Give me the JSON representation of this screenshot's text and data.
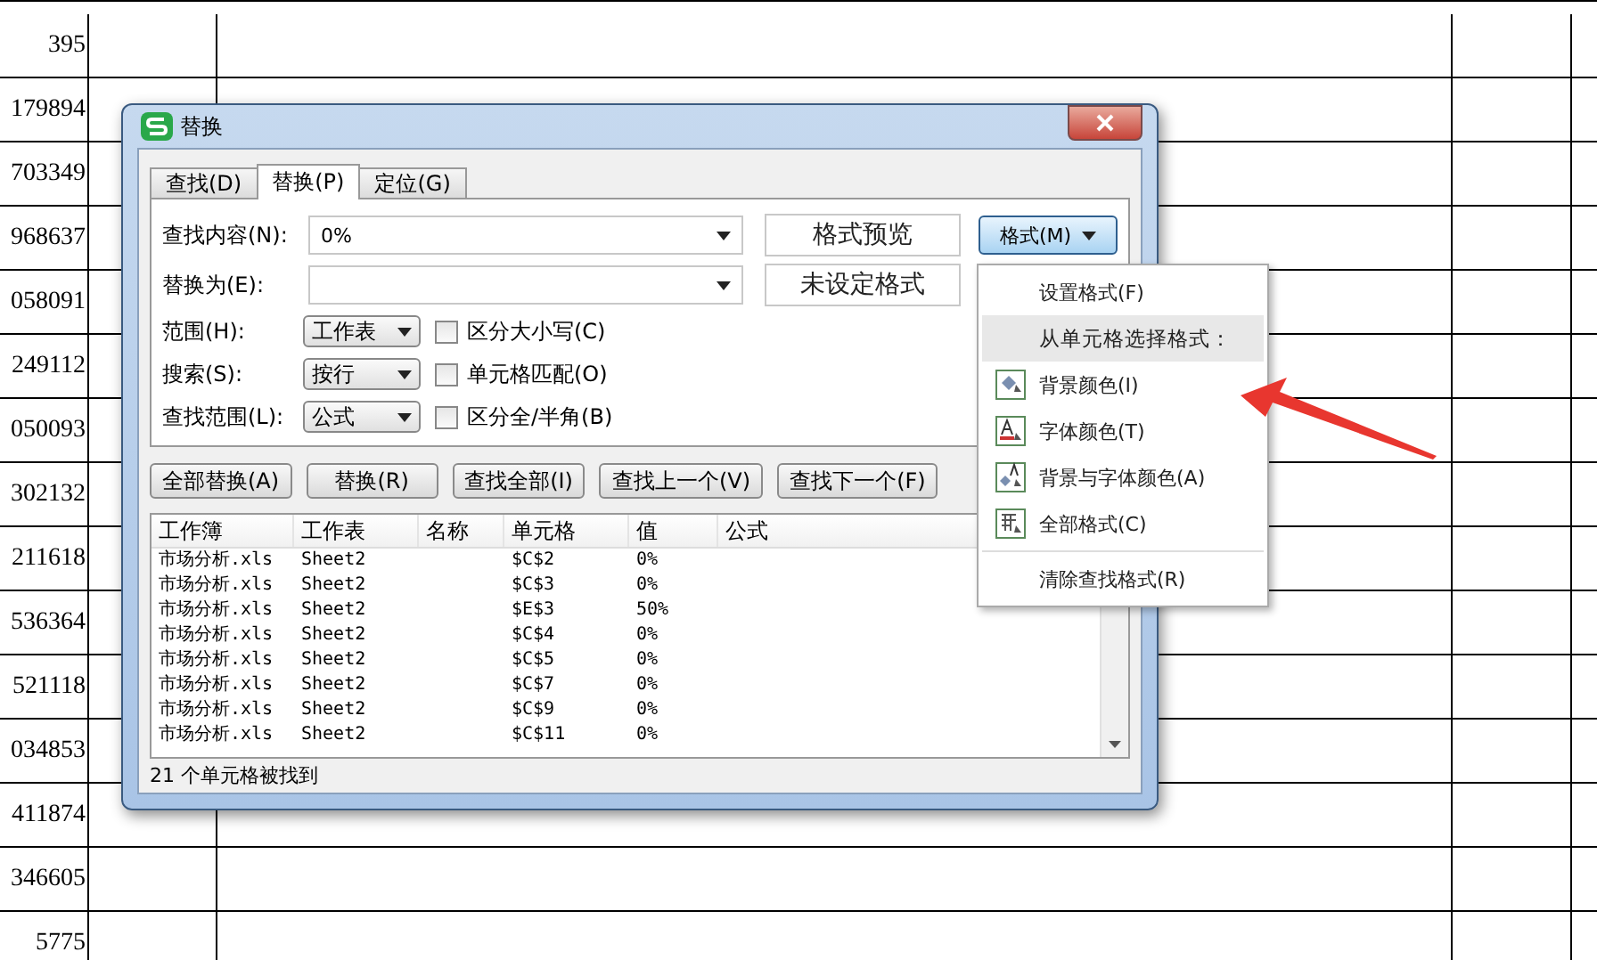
{
  "sheet": {
    "rows": [
      "395",
      "179894",
      "703349",
      "968637",
      "058091",
      "249112",
      "050093",
      "302132",
      "211618",
      "536364",
      "521118",
      "034853",
      "411874",
      "346605",
      "5775"
    ]
  },
  "window": {
    "title": "替换"
  },
  "tabs": [
    {
      "label": "查找(D)",
      "selected": false
    },
    {
      "label": "替换(P)",
      "selected": true
    },
    {
      "label": "定位(G)",
      "selected": false
    }
  ],
  "find_what": {
    "label": "查找内容(N):",
    "value": "0%"
  },
  "replace_with": {
    "label": "替换为(E):"
  },
  "format_preview": "格式预览",
  "format_status": "未设定格式",
  "format_button": {
    "label": "格式(M)",
    "expanded": true
  },
  "options": [
    {
      "label": "范围(H):",
      "value": "工作表",
      "checkbox_label": "区分大小写(C)",
      "checked": false
    },
    {
      "label": "搜索(S):",
      "value": "按行",
      "checkbox_label": "单元格匹配(O)",
      "checked": false
    },
    {
      "label": "查找范围(L):",
      "value": "公式",
      "checkbox_label": "区分全/半角(B)",
      "checked": false
    }
  ],
  "action_buttons": [
    "全部替换(A)",
    "替换(R)",
    "查找全部(I)",
    "查找上一个(V)",
    "查找下一个(F)"
  ],
  "results": {
    "columns": [
      "工作簿",
      "工作表",
      "名称",
      "单元格",
      "值",
      "公式"
    ],
    "rows": [
      [
        "市场分析.xls",
        "Sheet2",
        "",
        "$C$2",
        "0%",
        ""
      ],
      [
        "市场分析.xls",
        "Sheet2",
        "",
        "$C$3",
        "0%",
        ""
      ],
      [
        "市场分析.xls",
        "Sheet2",
        "",
        "$E$3",
        "50%",
        ""
      ],
      [
        "市场分析.xls",
        "Sheet2",
        "",
        "$C$4",
        "0%",
        ""
      ],
      [
        "市场分析.xls",
        "Sheet2",
        "",
        "$C$5",
        "0%",
        ""
      ],
      [
        "市场分析.xls",
        "Sheet2",
        "",
        "$C$7",
        "0%",
        ""
      ],
      [
        "市场分析.xls",
        "Sheet2",
        "",
        "$C$9",
        "0%",
        ""
      ],
      [
        "市场分析.xls",
        "Sheet2",
        "",
        "$C$11",
        "0%",
        ""
      ]
    ]
  },
  "status_text": "21 个单元格被找到",
  "format_menu": {
    "items": [
      {
        "label": "设置格式(F)",
        "kind": "plain",
        "selected": false
      },
      {
        "label": "从单元格选择格式：",
        "kind": "header",
        "selected": true
      },
      {
        "label": "背景颜色(I)",
        "kind": "background",
        "selected": false
      },
      {
        "label": "字体颜色(T)",
        "kind": "font",
        "selected": false
      },
      {
        "label": "背景与字体颜色(A)",
        "kind": "both",
        "selected": false
      },
      {
        "label": "全部格式(C)",
        "kind": "all",
        "selected": false
      },
      {
        "label": "清除查找格式(R)",
        "kind": "clear",
        "selected": false
      }
    ]
  }
}
